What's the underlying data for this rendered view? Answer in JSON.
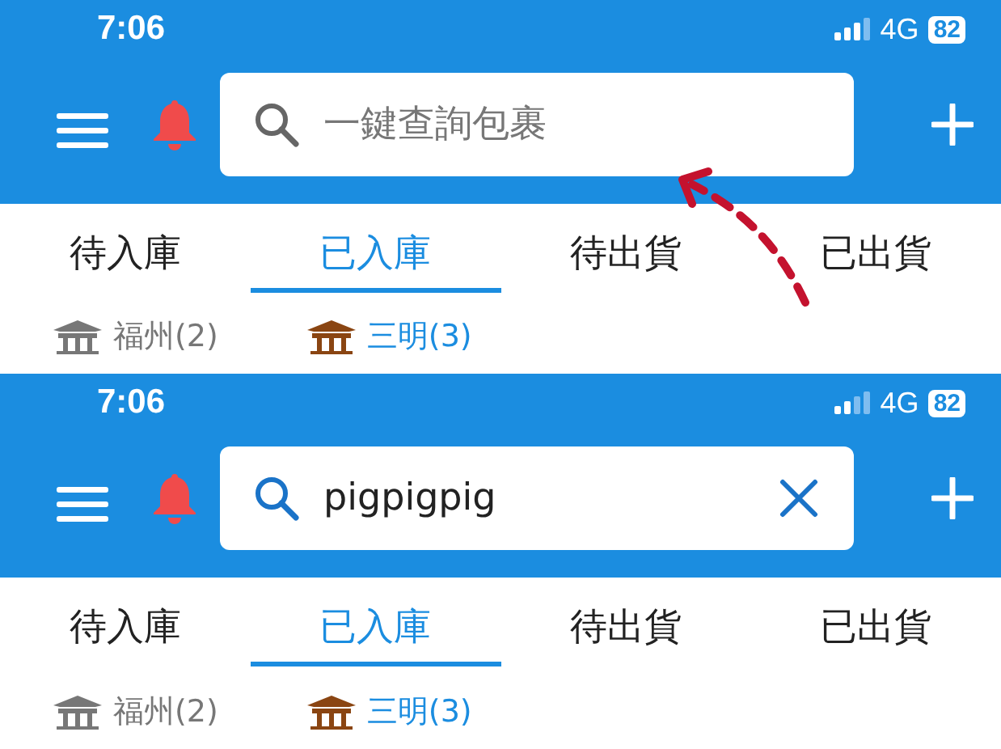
{
  "panels": [
    {
      "status": {
        "time": "7:06",
        "network": "4G",
        "battery": "82"
      },
      "search": {
        "placeholder": "一鍵查詢包裹",
        "clear": false
      },
      "annotation_arrow": true,
      "tabs": [
        {
          "label": "待入庫",
          "selected": false
        },
        {
          "label": "已入庫",
          "selected": true
        },
        {
          "label": "待出貨",
          "selected": false
        },
        {
          "label": "已出貨",
          "selected": false
        }
      ],
      "warehouses": [
        {
          "label": "福州(2)",
          "selected": false
        },
        {
          "label": "三明(3)",
          "selected": true
        }
      ]
    },
    {
      "status": {
        "time": "7:06",
        "network": "4G",
        "battery": "82"
      },
      "search": {
        "value": "pigpigpig",
        "clear": true
      },
      "annotation_arrow": false,
      "tabs": [
        {
          "label": "待入庫",
          "selected": false
        },
        {
          "label": "已入庫",
          "selected": true
        },
        {
          "label": "待出貨",
          "selected": false
        },
        {
          "label": "已出貨",
          "selected": false
        }
      ],
      "warehouses": [
        {
          "label": "福州(2)",
          "selected": false
        },
        {
          "label": "三明(3)",
          "selected": true
        }
      ]
    }
  ]
}
